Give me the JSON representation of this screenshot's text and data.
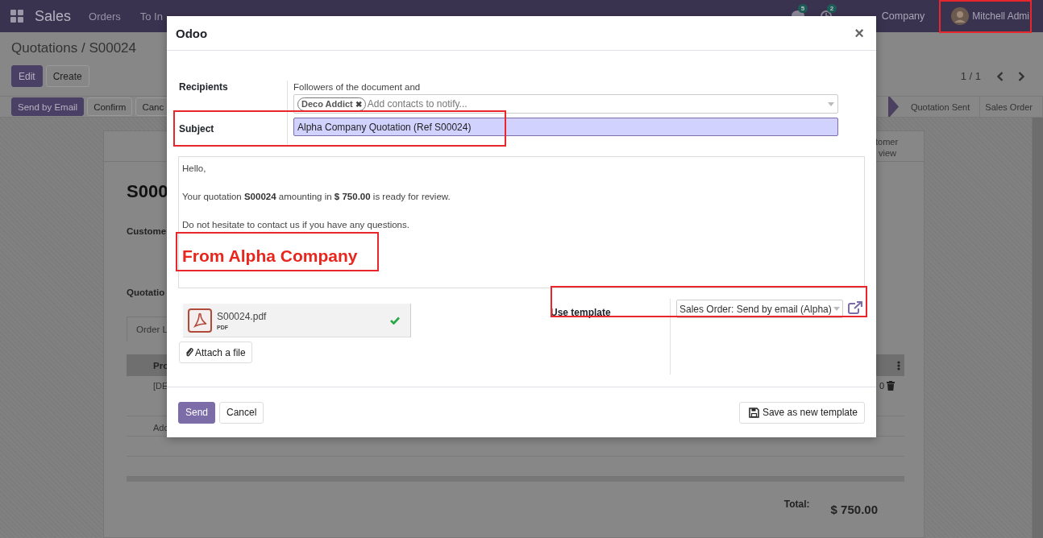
{
  "navbar": {
    "app": "Sales",
    "menu": [
      "Orders",
      "To In"
    ],
    "badges": [
      {
        "kind": "chat",
        "count": "5"
      },
      {
        "kind": "activity",
        "count": "2"
      }
    ],
    "company": "Company",
    "user": "Mitchell Admi"
  },
  "breadcrumb": "Quotations / S00024",
  "buttons": [
    {
      "label": "Edit",
      "kind": "primary"
    },
    {
      "label": "Create",
      "kind": "secondary"
    }
  ],
  "pager": "1 / 1",
  "actions": [
    {
      "label": "Send by Email",
      "kind": "primary"
    },
    {
      "label": "Confirm",
      "kind": "secondary"
    },
    {
      "label": "Canc",
      "kind": "secondary"
    }
  ],
  "statusbar": [
    {
      "label": "Quotation Sent",
      "selected": false
    },
    {
      "label": "Sales Order",
      "selected": false
    }
  ],
  "sheet": {
    "smart_button": [
      "tomer",
      "view"
    ],
    "title": "S000",
    "labels": [
      "Custome",
      "Quotatio"
    ],
    "tab": "Order L",
    "column": "Pro",
    "row": "[DE",
    "row_end": "0",
    "add_line": "Add",
    "total_label": "Total:",
    "total": "$ 750.00"
  },
  "dialog": {
    "title": "Odoo",
    "close": "×",
    "recipients": {
      "label": "Recipients",
      "text": "Followers of the document and",
      "tags": [
        {
          "label": "Deco Addict",
          "remove": "✖"
        }
      ],
      "placeholder": "Add contacts to notify..."
    },
    "subject": {
      "label": "Subject",
      "value": "Alpha Company Quotation (Ref S00024)"
    },
    "body": [
      "Hello,",
      "Your quotation **S00024** amounting in **$ 750.00** is ready for review.",
      "Do not hesitate to contact us if you have any questions."
    ],
    "signature": "From Alpha Company",
    "attachments": [
      {
        "name": "S00024.pdf",
        "type": "PDF",
        "uploaded": true
      }
    ],
    "attach_button": "Attach a file",
    "template": {
      "label": "Use template",
      "value": "Sales Order: Send by email (Alpha)"
    },
    "footer": [
      {
        "label": "Send",
        "kind": "primary"
      },
      {
        "label": "Cancel",
        "kind": "secondary"
      },
      {
        "label": "Save as new template",
        "kind": "save"
      }
    ]
  },
  "annotation_boxes": [
    {
      "kind": "user"
    },
    {
      "kind": "subject"
    },
    {
      "kind": "signature"
    },
    {
      "kind": "template"
    }
  ]
}
